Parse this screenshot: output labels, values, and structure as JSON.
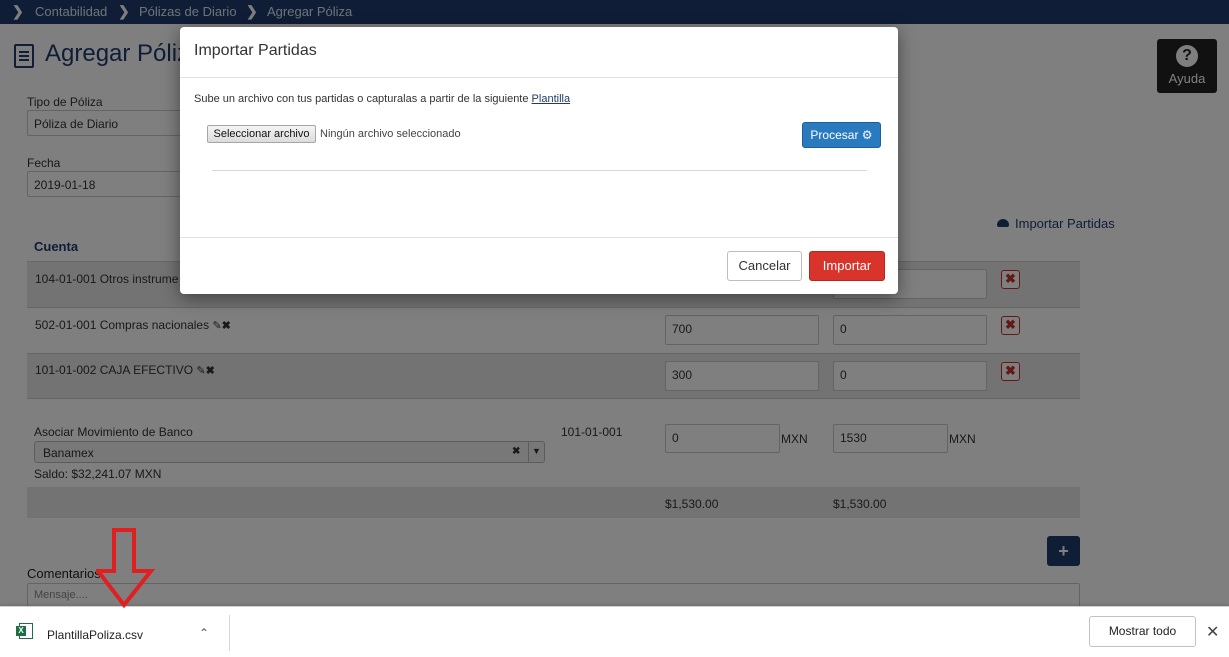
{
  "breadcrumb": [
    "Contabilidad",
    "Pólizas de Diario",
    "Agregar Póliza"
  ],
  "page": {
    "title": "Agregar Póliza",
    "help_label": "Ayuda",
    "tipo_label": "Tipo de Póliza",
    "tipo_value": "Póliza de Diario",
    "fecha_label": "Fecha",
    "fecha_value": "2019-01-18",
    "importar_link": "Importar Partidas",
    "cuenta_header": "Cuenta"
  },
  "rows": [
    {
      "cuenta": "104-01-001 Otros instrume",
      "debe": "",
      "haber": ""
    },
    {
      "cuenta": "502-01-001 Compras nacionales",
      "debe": "700",
      "haber": "0"
    },
    {
      "cuenta": "101-01-002 CAJA EFECTIVO",
      "debe": "300",
      "haber": "0"
    }
  ],
  "banco": {
    "label": "Asociar Movimiento de Banco",
    "selected": "Banamex",
    "saldo": "Saldo: $32,241.07 MXN",
    "cuenta": "101-01-001",
    "debe": "0",
    "haber": "1530",
    "currency": "MXN"
  },
  "totals": {
    "debe": "$1,530.00",
    "haber": "$1,530.00"
  },
  "comentarios": {
    "label": "Comentarios",
    "placeholder": "Mensaje...."
  },
  "modal": {
    "title": "Importar Partidas",
    "description": "Sube un archivo con tus partidas o capturalas a partir de la siguiente",
    "plantilla_link": "Plantilla",
    "file_button": "Seleccionar archivo",
    "file_status": "Ningún archivo seleccionado",
    "procesar": "Procesar",
    "cancelar": "Cancelar",
    "importar": "Importar"
  },
  "download_bar": {
    "filename": "PlantillaPoliza.csv",
    "show_all": "Mostrar todo"
  },
  "colors": {
    "navy": "#1f3b6e",
    "danger": "#d9342b",
    "primary": "#2a7ac0"
  }
}
